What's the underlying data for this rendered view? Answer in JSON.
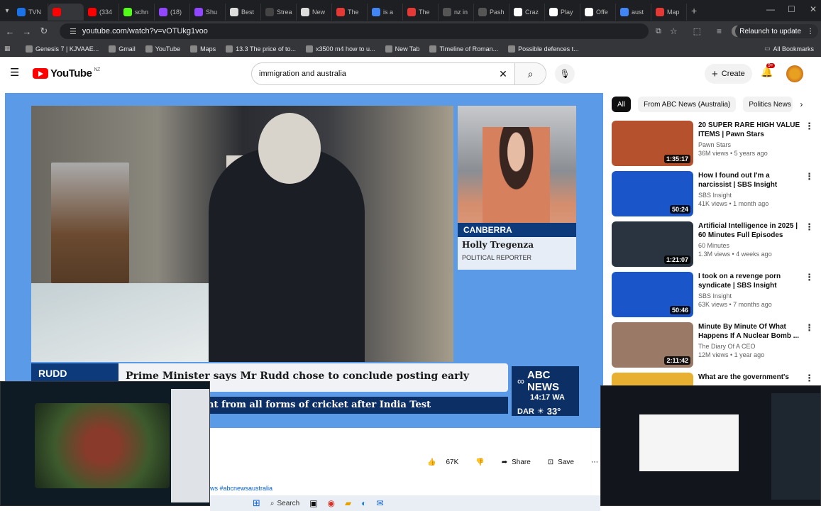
{
  "browser": {
    "tabs": [
      {
        "label": "TVN",
        "color": "#1a73e8"
      },
      {
        "label": "",
        "color": "#ff0000"
      },
      {
        "label": "(334",
        "color": "#ff0000"
      },
      {
        "label": "schn",
        "color": "#53fc18"
      },
      {
        "label": "(18)",
        "color": "#9146ff"
      },
      {
        "label": "Shu",
        "color": "#9146ff"
      },
      {
        "label": "Best",
        "color": "#dddddd"
      },
      {
        "label": "Strea",
        "color": "#444444"
      },
      {
        "label": "New",
        "color": "#dddddd"
      },
      {
        "label": "The",
        "color": "#e53935"
      },
      {
        "label": "is a",
        "color": "#4285f4"
      },
      {
        "label": "The",
        "color": "#e53935"
      },
      {
        "label": "nz in",
        "color": "#555555"
      },
      {
        "label": "Pash",
        "color": "#555555"
      },
      {
        "label": "Craz",
        "color": "#ffffff"
      },
      {
        "label": "Play",
        "color": "#ffffff"
      },
      {
        "label": "Offe",
        "color": "#ffffff"
      },
      {
        "label": "aust",
        "color": "#4285f4"
      },
      {
        "label": "Map",
        "color": "#e53935"
      }
    ],
    "url": "youtube.com/watch?v=vOTUkg1voo",
    "relaunch_label": "Relaunch to update",
    "bookmarks": [
      "Genesis 7 | KJVAAE...",
      "Gmail",
      "YouTube",
      "Maps",
      "13.3 The price of to...",
      "x3500 m4 how to u...",
      "New Tab",
      "Timeline of Roman...",
      "Possible defences t..."
    ],
    "all_bookmarks": "All Bookmarks"
  },
  "youtube": {
    "logo_text": "YouTube",
    "region": "NZ",
    "search_value": "immigration and australia",
    "create_label": "Create",
    "notif_count": "9+"
  },
  "video": {
    "reporter_location": "CANBERRA",
    "reporter_name": "Holly Tregenza",
    "reporter_role": "POLITICAL REPORTER",
    "tag": "RUDD",
    "headline": "Prime Minister says Mr Rudd chose to conclude posting early",
    "ticker": "nt from all forms of cricket after India Test",
    "network": "ABC NEWS",
    "time": "14:17 WA",
    "city": "DAR",
    "temp": "33°",
    "hashtags": "ws #abcnewsaustralia"
  },
  "actions": {
    "likes": "67K",
    "share": "Share",
    "save": "Save"
  },
  "chips": [
    "All",
    "From ABC News (Australia)",
    "Politics News"
  ],
  "recommendations": [
    {
      "title": "20 SUPER RARE HIGH VALUE ITEMS | Pawn Stars",
      "channel": "Pawn Stars",
      "meta": "36M views • 5 years ago",
      "duration": "1:35:17",
      "thumb": "#b5512c"
    },
    {
      "title": "How I found out I'm a narcissist | SBS Insight",
      "channel": "SBS Insight",
      "meta": "41K views • 1 month ago",
      "duration": "50:24",
      "thumb": "#1a56c9"
    },
    {
      "title": "Artificial Intelligence in 2025 | 60 Minutes Full Episodes",
      "channel": "60 Minutes",
      "meta": "1.3M views • 4 weeks ago",
      "duration": "1:21:07",
      "thumb": "#2a3340"
    },
    {
      "title": "I took on a revenge porn syndicate | SBS Insight",
      "channel": "SBS Insight",
      "meta": "63K views • 7 months ago",
      "duration": "50:46",
      "thumb": "#1a56c9"
    },
    {
      "title": "Minute By Minute Of What Happens If A Nuclear Bomb ...",
      "channel": "The Diary Of A CEO",
      "meta": "12M views • 1 year ago",
      "duration": "2:11:42",
      "thumb": "#9a7a66"
    },
    {
      "title": "What are the government's",
      "channel": "",
      "meta": "",
      "duration": "",
      "thumb": "#e8b030"
    }
  ],
  "taskbar": {
    "search": "Search"
  }
}
